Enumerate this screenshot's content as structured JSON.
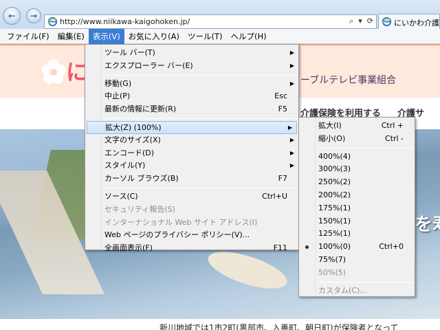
{
  "browser": {
    "url": "http://www.niikawa-kaigohoken.jp/",
    "address_tools": [
      "⌕",
      "▾",
      "⟳"
    ],
    "tab_title": "にいかわ介護"
  },
  "menubar": {
    "items": [
      {
        "label": "ファイル(F)"
      },
      {
        "label": "編集(E)"
      },
      {
        "label": "表示(V)"
      },
      {
        "label": "お気に入り(A)"
      },
      {
        "label": "ツール(T)"
      },
      {
        "label": "ヘルプ(H)"
      }
    ]
  },
  "page": {
    "title_fragment": "に",
    "subtitle": "ーブルテレビ事業組合",
    "nav_links": [
      "介護保険を利用する",
      "介護サ"
    ],
    "photo_text": "を寿",
    "body_text": "新川地域では1市2町(黒部市、入善町、朝日町)が保険者となって"
  },
  "view_menu": {
    "g1": [
      {
        "label": "ツール バー(T)"
      },
      {
        "label": "エクスプローラー バー(E)"
      }
    ],
    "g2": [
      {
        "label": "移動(G)"
      },
      {
        "label": "中止(P)",
        "shortcut": "Esc"
      },
      {
        "label": "最新の情報に更新(R)",
        "shortcut": "F5"
      }
    ],
    "g3": [
      {
        "label": "拡大(Z) (100%)"
      },
      {
        "label": "文字のサイズ(X)"
      },
      {
        "label": "エンコード(D)"
      },
      {
        "label": "スタイル(Y)"
      },
      {
        "label": "カーソル ブラウズ(B)",
        "shortcut": "F7"
      }
    ],
    "g4": [
      {
        "label": "ソース(C)",
        "shortcut": "Ctrl+U"
      },
      {
        "label": "セキュリティ報告(S)"
      },
      {
        "label": "インターナショナル Web サイト アドレス(I)"
      },
      {
        "label": "Web ページのプライバシー ポリシー(V)..."
      },
      {
        "label": "全画面表示(F)",
        "shortcut": "F11"
      }
    ]
  },
  "zoom_menu": {
    "g1": [
      {
        "label": "拡大(I)",
        "shortcut": "Ctrl +"
      },
      {
        "label": "縮小(O)",
        "shortcut": "Ctrl -"
      }
    ],
    "levels": [
      {
        "label": "400%(4)"
      },
      {
        "label": "300%(3)"
      },
      {
        "label": "250%(2)"
      },
      {
        "label": "200%(2)"
      },
      {
        "label": "175%(1)"
      },
      {
        "label": "150%(1)"
      },
      {
        "label": "125%(1)"
      },
      {
        "label": "100%(0)",
        "shortcut": "Ctrl+0"
      },
      {
        "label": "75%(7)"
      },
      {
        "label": "50%(5)"
      }
    ],
    "custom": {
      "label": "カスタム(C)..."
    }
  }
}
